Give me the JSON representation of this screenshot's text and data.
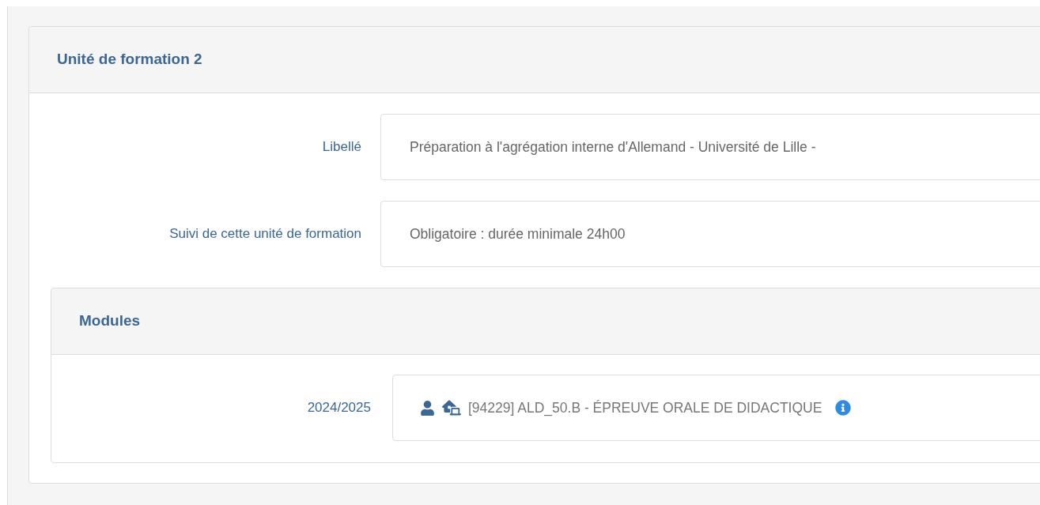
{
  "panel": {
    "title": "Unité de formation 2",
    "fields": [
      {
        "label": "Libellé",
        "value": "Préparation à l'agrégation interne d'Allemand - Université de Lille -"
      },
      {
        "label": "Suivi de cette unité de formation",
        "value": "Obligatoire : durée minimale 24h00"
      }
    ],
    "modules": {
      "title": "Modules",
      "rows": [
        {
          "label": "2024/2025",
          "value": "[94229] ALD_50.B - ÉPREUVE ORALE DE DIDACTIQUE"
        }
      ]
    }
  }
}
